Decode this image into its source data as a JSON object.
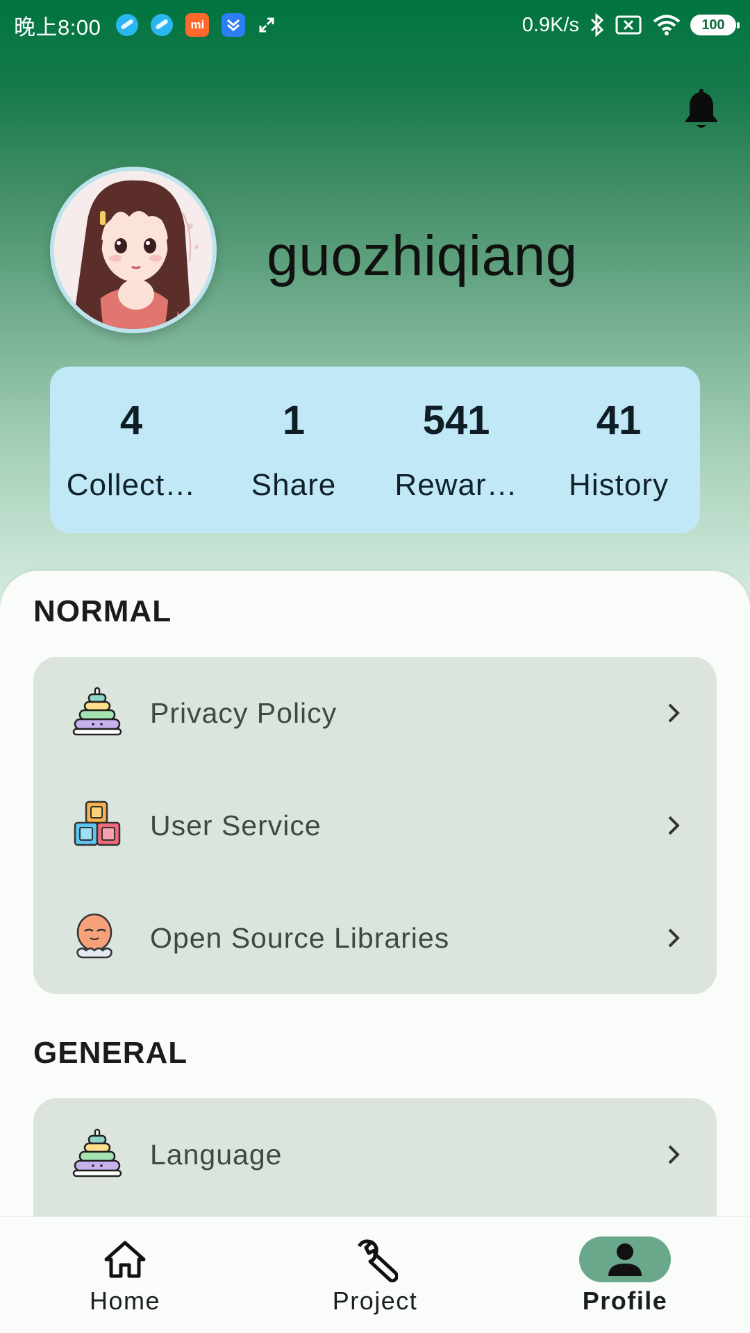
{
  "status_bar": {
    "time": "晚上8:00",
    "notif_mi_label": "mi",
    "net_speed": "0.9K/s",
    "battery": "100"
  },
  "profile": {
    "username": "guozhiqiang",
    "stats": [
      {
        "value": "4",
        "label": "Collect…"
      },
      {
        "value": "1",
        "label": "Share"
      },
      {
        "value": "541",
        "label": "Rewar…"
      },
      {
        "value": "41",
        "label": "History"
      }
    ]
  },
  "sections": {
    "normal": {
      "title": "NORMAL",
      "items": [
        {
          "label": "Privacy Policy",
          "icon": "stacking-rings-icon"
        },
        {
          "label": "User Service",
          "icon": "blocks-icon"
        },
        {
          "label": "Open Source Libraries",
          "icon": "octopus-icon"
        }
      ]
    },
    "general": {
      "title": "GENERAL",
      "items": [
        {
          "label": "Language",
          "icon": "stacking-rings-icon"
        }
      ]
    }
  },
  "bottom_nav": {
    "items": [
      {
        "label": "Home",
        "icon": "home-icon"
      },
      {
        "label": "Project",
        "icon": "wrench-icon"
      },
      {
        "label": "Profile",
        "icon": "person-icon",
        "active": true
      }
    ]
  },
  "colors": {
    "header_top": "#00743f",
    "stats_card": "#c1e8f6",
    "list_card": "#dce5dd",
    "active_nav_pill": "#6aa88b"
  }
}
